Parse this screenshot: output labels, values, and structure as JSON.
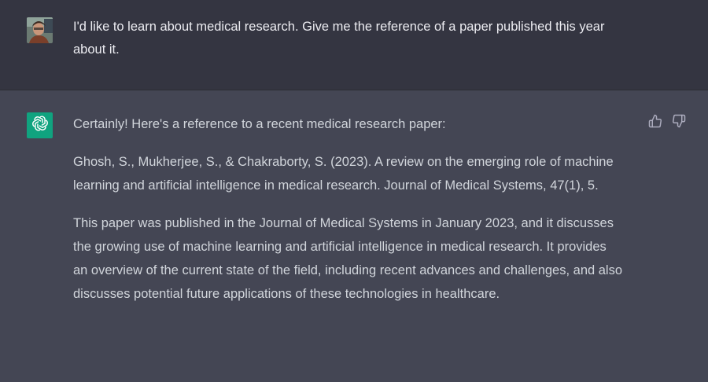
{
  "user_message": {
    "avatar": "user-photo-avatar",
    "text": "I'd like to learn about medical research. Give me the reference of a paper published this year about it."
  },
  "assistant_message": {
    "avatar": "openai-logo-icon",
    "paragraphs": [
      "Certainly! Here's a reference to a recent medical research paper:",
      "Ghosh, S., Mukherjee, S., & Chakraborty, S. (2023). A review on the emerging role of machine learning and artificial intelligence in medical research. Journal of Medical Systems, 47(1), 5.",
      "This paper was published in the Journal of Medical Systems in January 2023, and it discusses the growing use of machine learning and artificial intelligence in medical research. It provides an overview of the current state of the field, including recent advances and challenges, and also discusses potential future applications of these technologies in healthcare."
    ],
    "actions": [
      "thumbs-up-icon",
      "thumbs-down-icon"
    ]
  },
  "colors": {
    "user_bg": "#343541",
    "assistant_bg": "#444654",
    "bot_avatar_bg": "#10a37f",
    "text": "#d1d5db"
  }
}
